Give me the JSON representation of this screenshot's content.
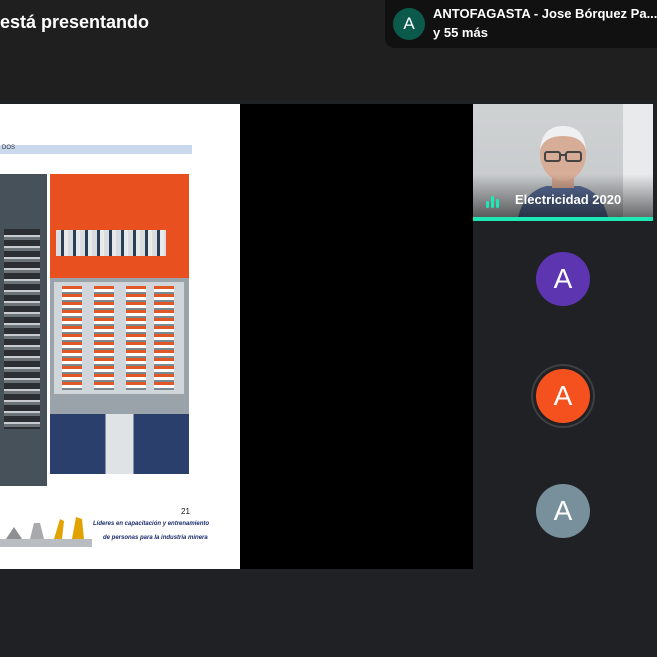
{
  "header": {
    "presenting_text": "está presentando",
    "presenter_chip": {
      "avatar_letter": "A",
      "name": "ANTOFAGASTA - Jose Bórquez Pa...",
      "more": "y 55 más",
      "avatar_color": "#0b5a4b"
    }
  },
  "slide": {
    "band_text": "DOS",
    "page_number": "21",
    "footer_line1": "Líderes en capacitación y entrenamiento",
    "footer_line2": "de personas para la industria minera"
  },
  "participants": {
    "video_tile": {
      "name": "Electricidad 2020",
      "speaking_color": "#1de9b6"
    },
    "avatars": [
      {
        "letter": "A",
        "color": "#5e35b1"
      },
      {
        "letter": "A",
        "color": "#f4511e"
      },
      {
        "letter": "A",
        "color": "#78909c"
      }
    ]
  }
}
